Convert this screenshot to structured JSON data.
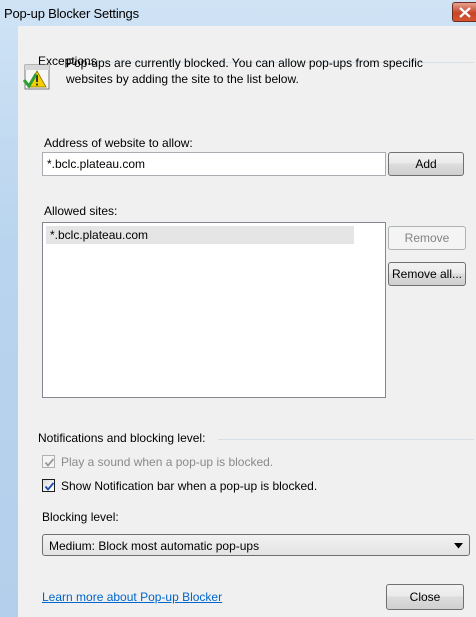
{
  "window": {
    "title": "Pop-up Blocker Settings"
  },
  "exceptions": {
    "group_label": "Exceptions",
    "info_line1": "Pop-ups are currently blocked.  You can allow pop-ups from specific",
    "info_line2": "websites by adding the site to the list below.",
    "address_label": "Address of website to allow:",
    "address_value": "*.bclc.plateau.com",
    "add_button": "Add",
    "allowed_label": "Allowed sites:",
    "allowed_sites": [
      "*.bclc.plateau.com"
    ],
    "remove_button": "Remove",
    "remove_all_button": "Remove all..."
  },
  "notifications": {
    "group_label": "Notifications and blocking level:",
    "play_sound_label": "Play a sound when a pop-up is blocked.",
    "play_sound_checked": true,
    "show_bar_label": "Show Notification bar when a pop-up is blocked.",
    "show_bar_checked": true,
    "blocking_label": "Blocking level:",
    "blocking_value": "Medium: Block most automatic pop-ups"
  },
  "footer": {
    "learn_more_link": "Learn more about Pop-up Blocker",
    "close_button": "Close"
  }
}
